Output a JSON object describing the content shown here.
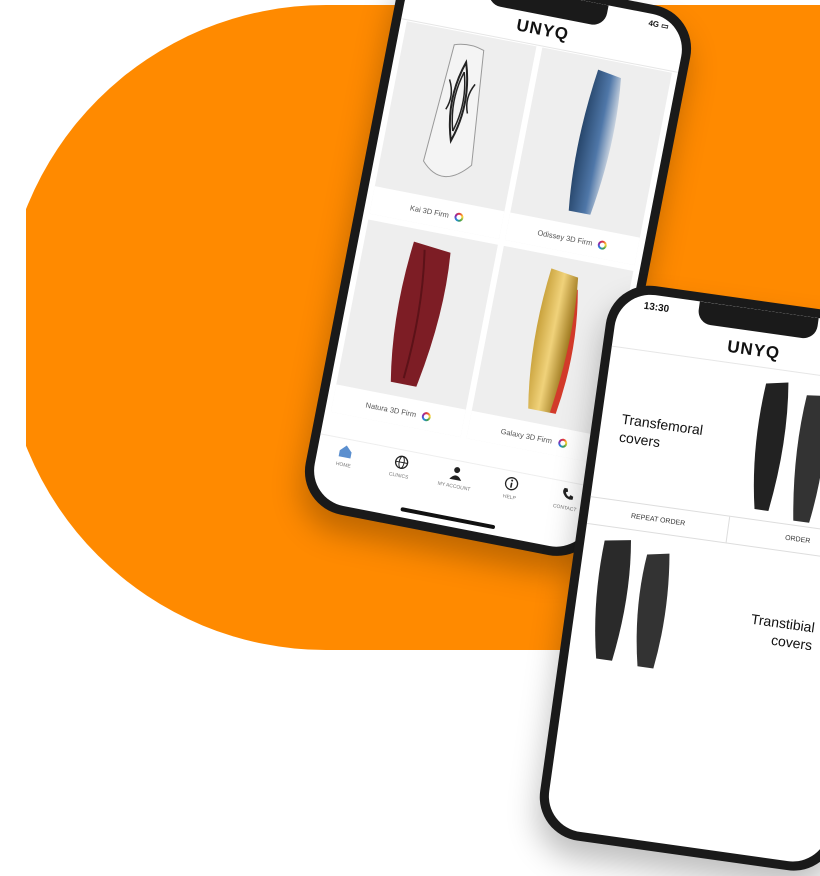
{
  "colors": {
    "background": "#ffffff",
    "accent": "#ff8a00",
    "phone": "#1a1a1a"
  },
  "phone_back": {
    "brand": "UNYQ",
    "status": "4G",
    "products": [
      {
        "name": "Kai 3D Firm"
      },
      {
        "name": "Odissey 3D Firm"
      },
      {
        "name": "Natura 3D Firm"
      },
      {
        "name": "Galaxy 3D Firm"
      }
    ],
    "tabs": [
      {
        "label": "HOME",
        "icon": "home-icon"
      },
      {
        "label": "CLINICS",
        "icon": "globe-icon"
      },
      {
        "label": "MY ACCOUNT",
        "icon": "user-icon"
      },
      {
        "label": "HELP",
        "icon": "info-icon"
      },
      {
        "label": "CONTACT",
        "icon": "phone-icon"
      }
    ]
  },
  "phone_front": {
    "time": "13:30",
    "brand": "UNYQ",
    "sections": [
      {
        "title": "Transfemoral covers"
      },
      {
        "title": "Transtibial covers"
      }
    ],
    "buttons": {
      "repeat_order": "REPEAT ORDER",
      "order": "ORDER"
    }
  }
}
